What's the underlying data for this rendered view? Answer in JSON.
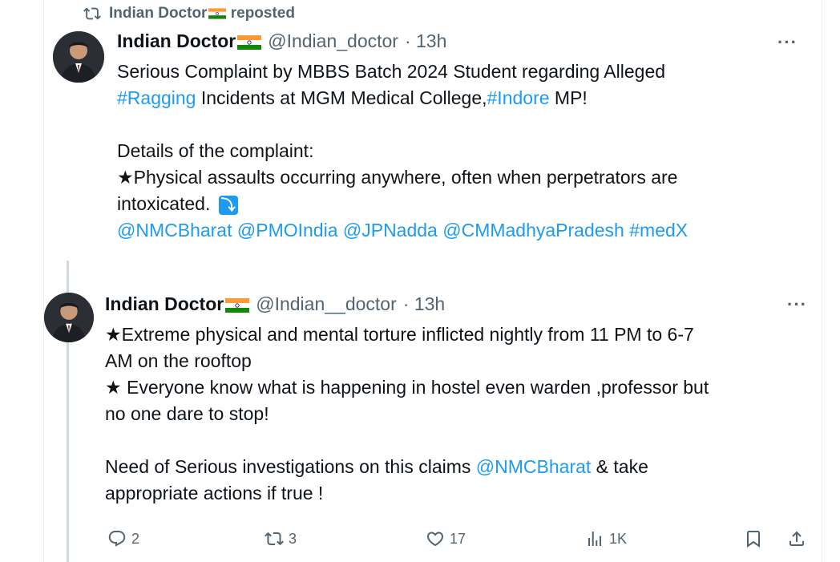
{
  "repost_bar": {
    "icon": "repost-icon",
    "text": "Indian Doctor",
    "suffix": "reposted"
  },
  "tweet1": {
    "name": "Indian Doctor",
    "handle": "@Indian_doctor",
    "time": "· 13h",
    "more": "···",
    "line1": "Serious Complaint by MBBS Batch 2024 Student regarding Alleged",
    "hashtag_ragging": "#Ragging",
    "line2_mid": " Incidents at MGM Medical College,",
    "hashtag_indore": "#Indore",
    "line2_end": " MP!",
    "details_heading": "Details of the complaint:",
    "bullet1_a": "★Physical assaults occurring anywhere, often when perpetrators are",
    "bullet1_b": "intoxicated.",
    "more_badge": "⤵",
    "mentions": "@NMCBharat @PMOIndia @JPNadda @CMMadhyaPradesh #medX"
  },
  "tweet2": {
    "name": "Indian Doctor",
    "handle": "@Indian__doctor",
    "time": "· 13h",
    "more": "···",
    "bullet1_a": "★Extreme physical and mental torture inflicted nightly from 11 PM to 6-7",
    "bullet1_b": "AM on the rooftop",
    "bullet2_a": "★ Everyone know what is happening in hostel even warden ,professor but",
    "bullet2_b": "no one dare to stop!",
    "closing_a": "Need of Serious investigations on this claims ",
    "closing_mention": "@NMCBharat",
    "closing_b": " & take",
    "closing_c": "appropriate actions if true !"
  },
  "actions": {
    "replies": "2",
    "reposts": "3",
    "likes": "17",
    "views": "1K"
  },
  "colors": {
    "link": "#1d9bf0",
    "muted": "#536471",
    "text": "#0f1419"
  }
}
